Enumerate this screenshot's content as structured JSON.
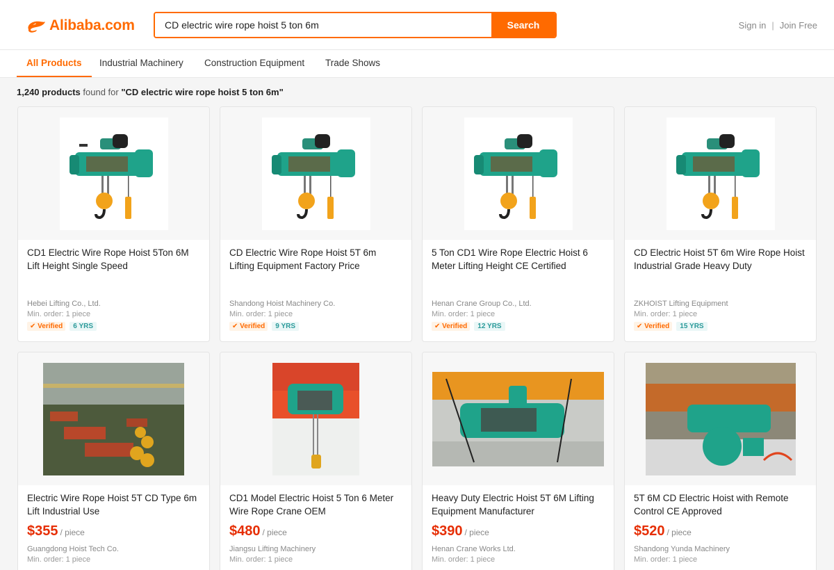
{
  "header": {
    "logo_text": "Alibaba.com",
    "search_value": "CD electric wire rope hoist 5 ton 6m",
    "search_button": "Search",
    "sign_in": "Sign in",
    "separator": "|",
    "join_free": "Join Free"
  },
  "nav": {
    "tabs": [
      {
        "label": "All Products"
      },
      {
        "label": "Industrial Machinery"
      },
      {
        "label": "Construction Equipment"
      },
      {
        "label": "Trade Shows"
      }
    ]
  },
  "results": {
    "count": "1,240 products",
    "found_for": "found for",
    "query": "\"CD electric wire rope hoist 5 ton 6m\""
  },
  "products": [
    {
      "title": "CD1 Electric Wire Rope Hoist 5Ton 6M Lift Height Single Speed",
      "supplier": "Hebei Lifting Co., Ltd.",
      "moq": "Min. order: 1 piece",
      "verified": "✔ Verified",
      "years": "6 YRS"
    },
    {
      "title": "CD Electric Wire Rope Hoist 5T 6m Lifting Equipment Factory Price",
      "supplier": "Shandong Hoist Machinery Co.",
      "moq": "Min. order: 1 piece",
      "verified": "✔ Verified",
      "years": "9 YRS"
    },
    {
      "title": "5 Ton CD1 Wire Rope Electric Hoist 6 Meter Lifting Height CE Certified",
      "supplier": "Henan Crane Group Co., Ltd.",
      "moq": "Min. order: 1 piece",
      "verified": "✔ Verified",
      "years": "12 YRS"
    },
    {
      "title": "CD Electric Hoist 5T 6m Wire Rope Hoist Industrial Grade Heavy Duty",
      "supplier": "ZKHOIST Lifting Equipment",
      "moq": "Min. order: 1 piece",
      "verified": "✔ Verified",
      "years": "15 YRS"
    },
    {
      "title": "Electric Wire Rope Hoist 5T CD Type 6m Lift Industrial Use",
      "price": "$355",
      "unit": "/ piece",
      "supplier": "Guangdong Hoist Tech Co.",
      "moq": "Min. order: 1 piece"
    },
    {
      "title": "CD1 Model Electric Hoist 5 Ton 6 Meter Wire Rope Crane OEM",
      "price": "$480",
      "unit": "/ piece",
      "supplier": "Jiangsu Lifting Machinery",
      "moq": "Min. order: 1 piece"
    },
    {
      "title": "Heavy Duty Electric Hoist 5T 6M Lifting Equipment Manufacturer",
      "price": "$390",
      "unit": "/ piece",
      "supplier": "Henan Crane Works Ltd.",
      "moq": "Min. order: 1 piece"
    },
    {
      "title": "5T 6M CD Electric Hoist with Remote Control CE Approved",
      "price": "$520",
      "unit": "/ piece",
      "supplier": "Shandong Yunda Machinery",
      "moq": "Min. order: 1 piece"
    }
  ],
  "colors": {
    "brand": "#ff6a00",
    "price": "#e62e04",
    "hoist": "#1fa38a"
  }
}
